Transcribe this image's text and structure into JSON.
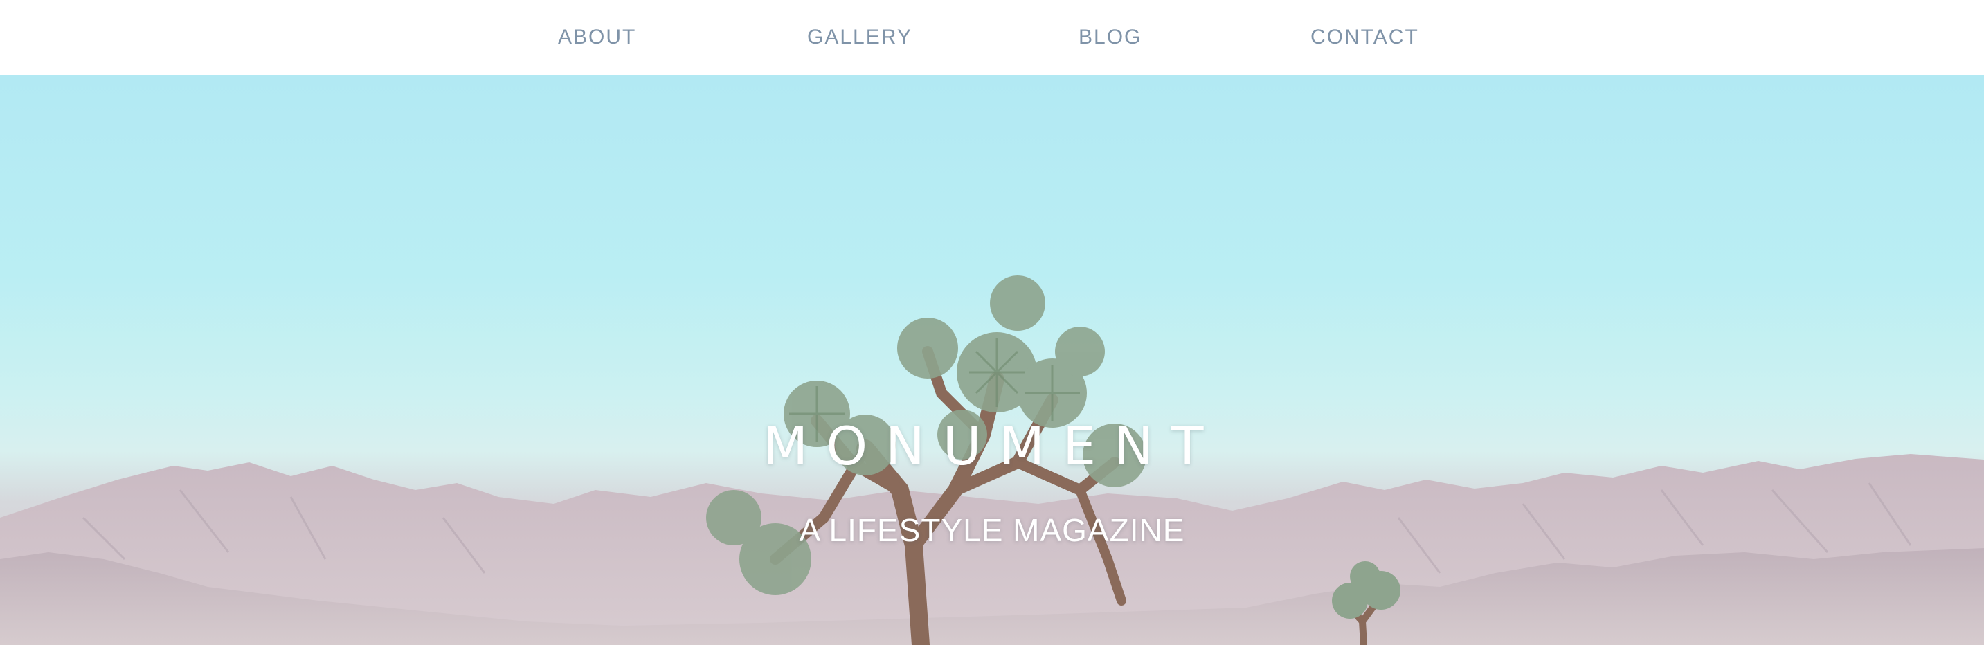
{
  "nav": {
    "items": [
      {
        "label": "ABOUT"
      },
      {
        "label": "GALLERY"
      },
      {
        "label": "BLOG"
      },
      {
        "label": "CONTACT"
      }
    ]
  },
  "hero": {
    "title": "MONUMENT",
    "tagline": "A LIFESTYLE MAGAZINE",
    "image": "desert-mountains-joshua-trees"
  },
  "colors": {
    "nav_text": "#7f93a8",
    "sky": "#b2e9f3",
    "mountains": "#cdbfc6"
  }
}
